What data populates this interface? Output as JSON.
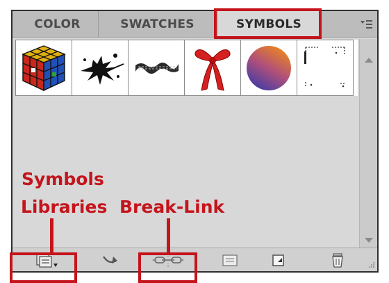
{
  "panel": {
    "tabs": [
      {
        "label": "COLOR"
      },
      {
        "label": "SWATCHES"
      },
      {
        "label": "SYMBOLS"
      }
    ],
    "active_tab": "SYMBOLS",
    "menu_icon": "panel-menu-icon"
  },
  "symbols": [
    {
      "icon": "rubiks-cube-icon"
    },
    {
      "icon": "ink-splat-icon"
    },
    {
      "icon": "brush-stroke-icon"
    },
    {
      "icon": "red-ribbon-bow-icon"
    },
    {
      "icon": "gradient-sphere-icon"
    },
    {
      "icon": "dotted-frame-icon"
    }
  ],
  "toolbar": {
    "tools": [
      {
        "icon": "symbol-libraries-menu-icon"
      },
      {
        "icon": "place-symbol-instance-icon"
      },
      {
        "icon": "break-link-icon"
      },
      {
        "icon": "symbol-options-icon"
      },
      {
        "icon": "new-symbol-icon"
      },
      {
        "icon": "delete-symbol-icon"
      }
    ]
  },
  "annotations": {
    "libraries_line1": "Symbols",
    "libraries_line2": "Libraries",
    "breaklink": "Break-Link"
  },
  "colors": {
    "annotation_red": "#c4141c",
    "panel_bg": "#d8d8d8",
    "tab_bar_bg": "#bcbcbc"
  }
}
